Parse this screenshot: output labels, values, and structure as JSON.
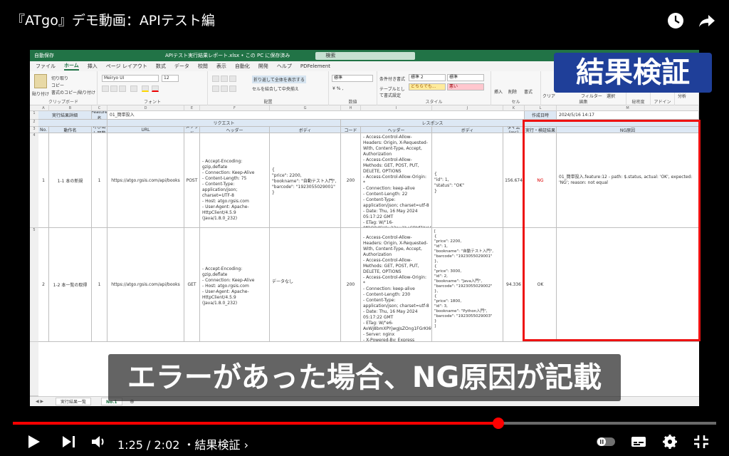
{
  "video": {
    "title": "『ATgo』デモ動画：APIテスト編",
    "time": "1:25 / 2:02",
    "chapter": "・結果検証 ›",
    "progress_fraction": 0.69,
    "overlay_title": "結果検証",
    "subtitle": "エラーがあった場合、NG原因が記載"
  },
  "excel": {
    "autosave": "自動保存",
    "filename": "APIテスト実行結果レポート.xlsx • この PC に保存済み",
    "search": "検索",
    "menu": [
      "ファイル",
      "ホーム",
      "挿入",
      "ページ レイアウト",
      "数式",
      "データ",
      "校閲",
      "表示",
      "自動化",
      "開発",
      "ヘルプ",
      "PDFelement"
    ],
    "ribbon": {
      "clipboard": "クリップボード",
      "paste": "貼り付け",
      "cut": "切り取り",
      "copy": "コピー",
      "format_painter": "書式のコピー/貼り付け",
      "font_group": "フォント",
      "font": "Meiryo UI",
      "size": "12",
      "align_group": "配置",
      "wrap": "折り返して全体を表示する",
      "merge": "セルを結合して中央揃え",
      "number_group": "数値",
      "number_format": "標準",
      "cond_format": "条件付き書式",
      "table_format": "テーブルとして書式設定",
      "style_group": "スタイル",
      "style1": "標準 2",
      "style2": "標準",
      "style3": "どちらでも...",
      "style4": "悪い",
      "cells_group": "セル",
      "insert": "挿入",
      "delete": "削除",
      "format": "書式",
      "edit_group": "編集",
      "clear": "クリア",
      "filter": "フィルター",
      "select": "選択",
      "sensitivity": "秘密度",
      "addin": "アドイン",
      "analyze": "分析"
    },
    "sheet": {
      "report_label": "実行結果詳細",
      "feature_label": "Feature名",
      "feature_value": "01_簡単投入",
      "created_label": "作成日時",
      "created_value": "2024/5/16 14:17",
      "request_header": "リクエスト",
      "response_header": "レスポンス",
      "columns": {
        "no": "No.",
        "action": "動作名",
        "calls": "呼び出し回数",
        "url": "URL",
        "method": "メソッド",
        "req_headers": "ヘッダー",
        "req_body": "ボディ",
        "code": "コード",
        "res_headers": "ヘッダー",
        "res_body": "ボディ",
        "time": "タイム(ms)",
        "result": "実行・検証結果",
        "reason": "NG原因"
      },
      "rows": [
        {
          "no": "1",
          "action": "1-1 本の新規",
          "calls": "1",
          "url": "https://atgo.rgsis.com/api/books",
          "method": "POST",
          "req_headers": "- Accept-Encoding: gzip,deflate\n- Connection: Keep-Alive\n- Content-Length: 75\n- Content-Type: application/json; charset=UTF-8\n- Host: atgo.rgsis.com\n- User-Agent: Apache-HttpClient/4.5.9 (Java/1.8.0_232)",
          "req_body": "{\n\"price\": 2200,\n\"bookname\": \"自動テスト入門\",\n\"barcode\": \"1923055029001\"\n}",
          "code": "200",
          "res_headers": "- Access-Control-Allow-Headers: Origin, X-Requested-With, Content-Type, Accept, Authorization\n- Access-Control-Allow-Methods: GET, POST, PUT, DELETE, OPTIONS\n- Access-Control-Allow-Origin: *\n- Connection: keep-alive\n- Content-Length: 22\n- Content-Type: application/json; charset=utf-8\n- Date: Thu, 16 May 2024 05:17:22 GMT\n- ETag: W/\"16-0fOQ8dCUku23sw1boCBbf7XsHY\"\n- Server: nginx\n- X-Powered-By: Express",
          "res_body": "{\n\"id\": 1,\n\"status\": \"OK\"\n}",
          "time": "156.674",
          "result": "NG",
          "reason": "01_簡単投入.feature:12 - path: $.status, actual: 'OK', expected: 'NG'; reason: not equal"
        },
        {
          "no": "2",
          "action": "1-2 本一覧の取得",
          "calls": "1",
          "url": "https://atgo.rgsis.com/api/books",
          "method": "GET",
          "req_headers": "- Accept-Encoding: gzip,deflate\n- Connection: Keep-Alive\n- Host: atgo.rgsis.com\n- User-Agent: Apache-HttpClient/4.5.9 (Java/1.8.0_232)",
          "req_body": "データなし",
          "code": "200",
          "res_headers": "- Access-Control-Allow-Headers: Origin, X-Requested-With, Content-Type, Accept, Authorization\n- Access-Control-Allow-Methods: GET, POST, PUT, DELETE, OPTIONS\n- Access-Control-Allow-Origin: *\n- Connection: keep-alive\n- Content-Length: 230\n- Content-Type: application/json; charset=utf-8\n- Date: Thu, 16 May 2024 05:17:22 GMT\n- ETag: W/\"e6-AvWj8bmXPYjwgJsZOng1FGrKI6U\"\n- Server: nginx\n- X-Powered-By: Express",
          "res_body": "[\n{\n\"price\": 2200,\n\"id\": 1,\n\"bookname\": \"自動テスト入門\",\n\"barcode\": \"1923055029001\"\n},\n{\n\"price\": 3000,\n\"id\": 2,\n\"bookname\": \"Java入門\",\n\"barcode\": \"1923055029002\"\n},\n{\n\"price\": 1800,\n\"id\": 3,\n\"bookname\": \"Python入門\",\n\"barcode\": \"1923055029003\"\n}\n]",
          "time": "94.336",
          "result": "OK",
          "reason": ""
        }
      ],
      "tabs": [
        "実行結果一覧",
        "No.1"
      ]
    }
  }
}
